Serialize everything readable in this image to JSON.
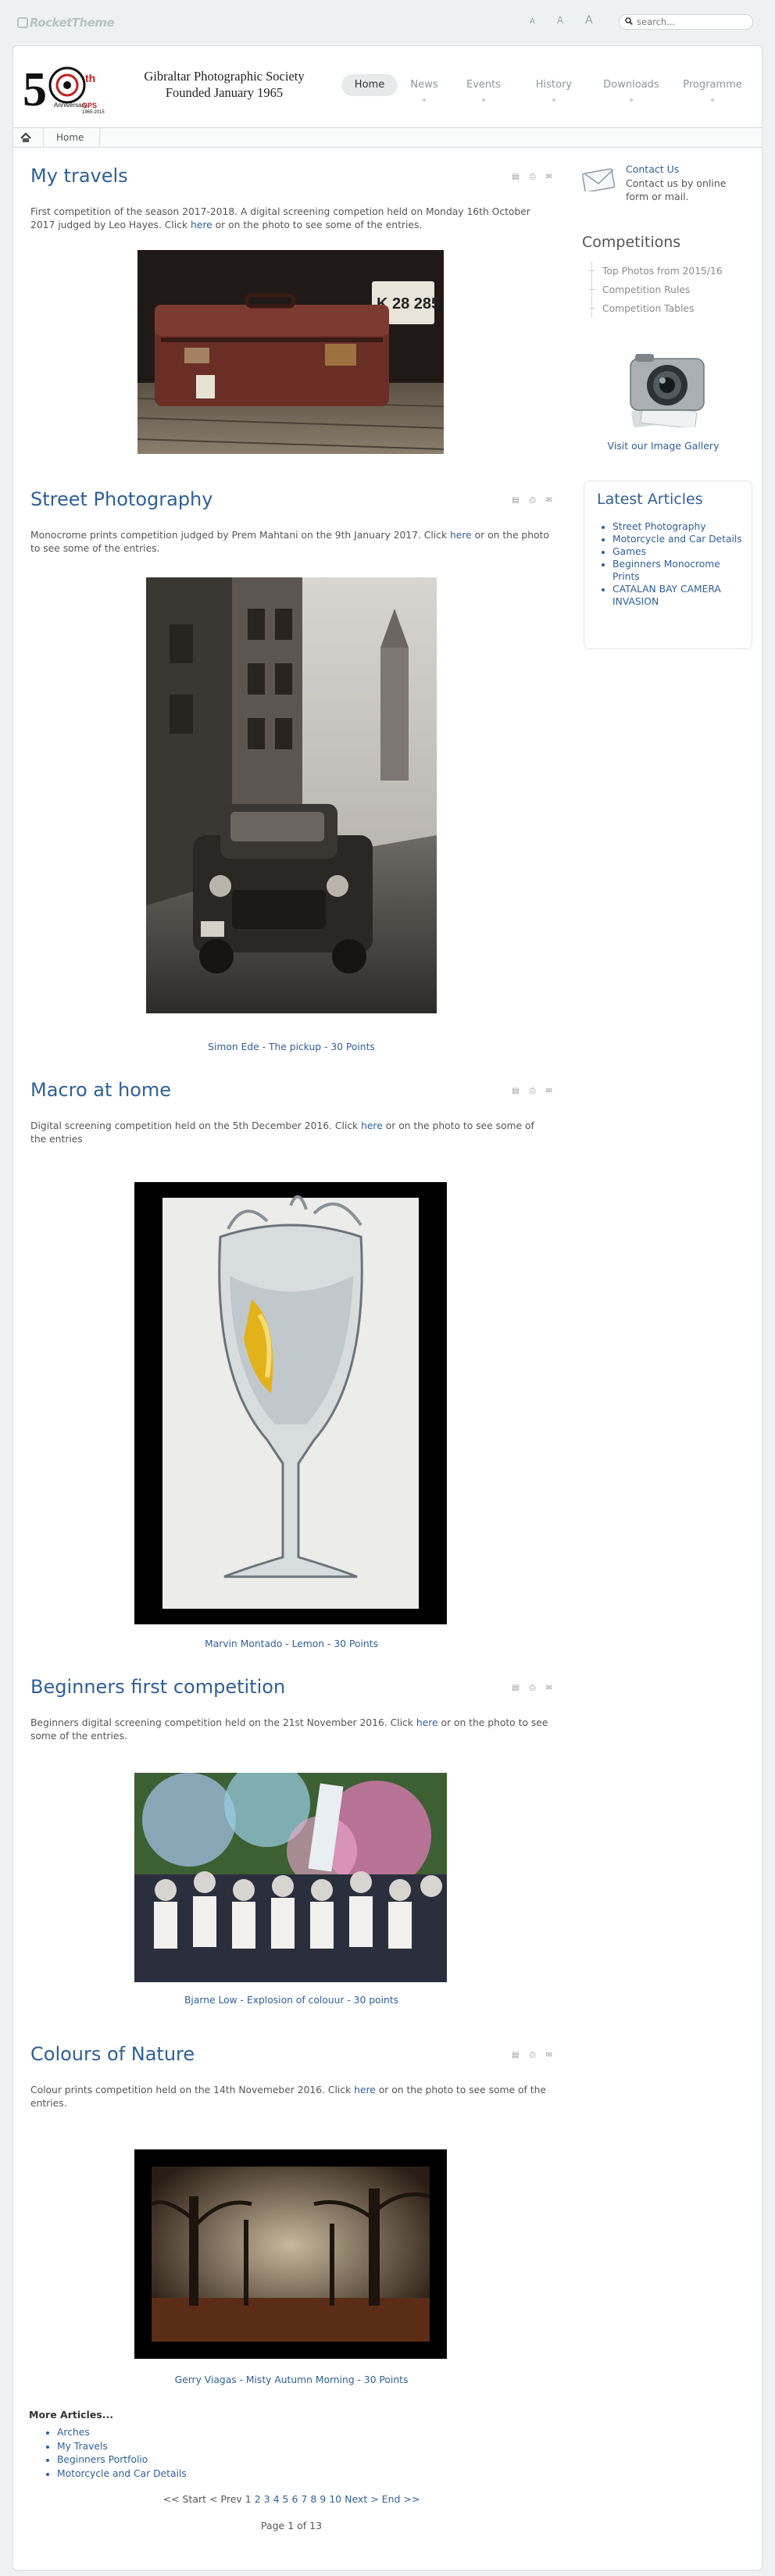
{
  "topbar": {
    "brand": "RocketTheme",
    "font_sizes": [
      "A",
      "A",
      "A"
    ],
    "search_placeholder": "search..."
  },
  "header": {
    "logo_anniversary": "50",
    "logo_suffix": "th",
    "society_name": "Gibraltar Photographic Society",
    "founded": "Founded January 1965",
    "nav": [
      "Home",
      "News",
      "Events",
      "History",
      "Downloads",
      "Programme"
    ],
    "active_nav": "Home"
  },
  "breadcrumb": {
    "home": "Home"
  },
  "articles": [
    {
      "title": "My travels",
      "text_before": "First competition of the season 2017-2018. A digital screening competion held on Monday 16th October 2017  judged by Leo Hayes. Click ",
      "link": "here",
      "text_after": " or on the photo to see some of the entries.",
      "caption": "",
      "plate": "K 28 285"
    },
    {
      "title": "Street Photography",
      "text_before": "Monocrome prints competition judged by Prem Mahtani on the 9th January 2017. Click ",
      "link": "here",
      "text_after": " or on the photo to see some of the entries.",
      "caption": "Simon Ede - The pickup - 30 Points"
    },
    {
      "title": "Macro at home",
      "text_before": "Digital screening competition held on the 5th December 2016. Click ",
      "link": "here",
      "text_after": " or on the photo to see some of the entries",
      "caption": "Marvin Montado - Lemon - 30 Points"
    },
    {
      "title": "Beginners first competition",
      "text_before": "Beginners digital screening competition held on the 21st November 2016. Click ",
      "link": "here",
      "text_after": " or on the photo to see some of the entries.",
      "caption": "Bjarne Low - Explosion of colouur - 30 points"
    },
    {
      "title": "Colours of Nature",
      "text_before": "Colour prints competition held on the 14th Novemeber 2016. Click ",
      "link": "here",
      "text_after": " or on the photo to see some of the entries.",
      "caption": "Gerry Viagas - Misty Autumn Morning - 30 Points"
    }
  ],
  "sidebar": {
    "contact_link": "Contact Us",
    "contact_text": "Contact us by online form or mail.",
    "competitions_title": "Competitions",
    "competitions": [
      "Top Photos from 2015/16",
      "Competition Rules",
      "Competition Tables"
    ],
    "gallery_link": "Visit our Image Gallery",
    "latest_title": "Latest Articles",
    "latest": [
      "Street Photography",
      "Motorcycle and Car Details",
      "Games",
      "Beginners Monocrome Prints",
      "CATALAN BAY CAMERA INVASION"
    ]
  },
  "more": {
    "title": "More Articles...",
    "items": [
      "Arches",
      "My Travels",
      "Beginners Portfolio",
      "Motorcycle and Car Details"
    ]
  },
  "pagination": {
    "start": "<< Start",
    "prev": "< Prev",
    "pages": [
      "1",
      "2",
      "3",
      "4",
      "5",
      "6",
      "7",
      "8",
      "9",
      "10"
    ],
    "next": "Next >",
    "end": "End >>",
    "page_of": "Page 1 of 13"
  }
}
